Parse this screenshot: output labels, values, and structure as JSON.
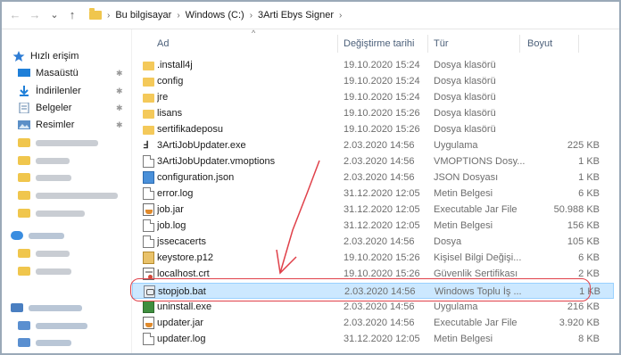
{
  "nav": {
    "back_glyph": "←",
    "forward_glyph": "→",
    "recent_glyph": "⌄",
    "up_glyph": "↑"
  },
  "breadcrumb": {
    "items": [
      "Bu bilgisayar",
      "Windows (C:)",
      "3Arti Ebys Signer"
    ],
    "separator": "›"
  },
  "columns": {
    "name": "Ad",
    "date": "Değiştirme tarihi",
    "type": "Tür",
    "size": "Boyut"
  },
  "sidebar": {
    "quick_access": "Hızlı erişim",
    "items": [
      {
        "label": "Masaüstü",
        "icon": "desktop-icon"
      },
      {
        "label": "İndirilenler",
        "icon": "download-icon"
      },
      {
        "label": "Belgeler",
        "icon": "documents-icon"
      },
      {
        "label": "Resimler",
        "icon": "pictures-icon"
      }
    ]
  },
  "files": [
    {
      "name": ".install4j",
      "date": "19.10.2020 15:24",
      "type": "Dosya klasörü",
      "size": "",
      "icon": "folder-icon"
    },
    {
      "name": "config",
      "date": "19.10.2020 15:24",
      "type": "Dosya klasörü",
      "size": "",
      "icon": "folder-icon"
    },
    {
      "name": "jre",
      "date": "19.10.2020 15:24",
      "type": "Dosya klasörü",
      "size": "",
      "icon": "folder-icon"
    },
    {
      "name": "lisans",
      "date": "19.10.2020 15:26",
      "type": "Dosya klasörü",
      "size": "",
      "icon": "folder-icon"
    },
    {
      "name": "sertifikadeposu",
      "date": "19.10.2020 15:26",
      "type": "Dosya klasörü",
      "size": "",
      "icon": "folder-icon"
    },
    {
      "name": "3ArtiJobUpdater.exe",
      "date": "2.03.2020 14:56",
      "type": "Uygulama",
      "size": "225 KB",
      "icon": "exe-icon"
    },
    {
      "name": "3ArtiJobUpdater.vmoptions",
      "date": "2.03.2020 14:56",
      "type": "VMOPTIONS Dosy...",
      "size": "1 KB",
      "icon": "file-icon"
    },
    {
      "name": "configuration.json",
      "date": "2.03.2020 14:56",
      "type": "JSON Dosyası",
      "size": "1 KB",
      "icon": "json-icon"
    },
    {
      "name": "error.log",
      "date": "31.12.2020 12:05",
      "type": "Metin Belgesi",
      "size": "6 KB",
      "icon": "text-file-icon"
    },
    {
      "name": "job.jar",
      "date": "31.12.2020 12:05",
      "type": "Executable Jar File",
      "size": "50.988 KB",
      "icon": "jar-icon"
    },
    {
      "name": "job.log",
      "date": "31.12.2020 12:05",
      "type": "Metin Belgesi",
      "size": "156 KB",
      "icon": "text-file-icon"
    },
    {
      "name": "jssecacerts",
      "date": "2.03.2020 14:56",
      "type": "Dosya",
      "size": "105 KB",
      "icon": "file-icon"
    },
    {
      "name": "keystore.p12",
      "date": "19.10.2020 15:26",
      "type": "Kişisel Bilgi Değişi...",
      "size": "6 KB",
      "icon": "key-icon"
    },
    {
      "name": "localhost.crt",
      "date": "19.10.2020 15:26",
      "type": "Güvenlik Sertifikası",
      "size": "2 KB",
      "icon": "certificate-icon"
    },
    {
      "name": "stopjob.bat",
      "date": "2.03.2020 14:56",
      "type": "Windows Toplu İş ...",
      "size": "1 KB",
      "icon": "batch-icon",
      "selected": true
    },
    {
      "name": "uninstall.exe",
      "date": "2.03.2020 14:56",
      "type": "Uygulama",
      "size": "216 KB",
      "icon": "uninstall-icon"
    },
    {
      "name": "updater.jar",
      "date": "2.03.2020 14:56",
      "type": "Executable Jar File",
      "size": "3.920 KB",
      "icon": "jar-icon"
    },
    {
      "name": "updater.log",
      "date": "31.12.2020 12:05",
      "type": "Metin Belgesi",
      "size": "8 KB",
      "icon": "text-file-icon"
    }
  ],
  "colors": {
    "selection_bg": "#cce8ff",
    "selection_border": "#99d1ff",
    "annotation": "#e0414a",
    "folder": "#f4c95a",
    "quick_access_star": "#2f7dd4"
  }
}
